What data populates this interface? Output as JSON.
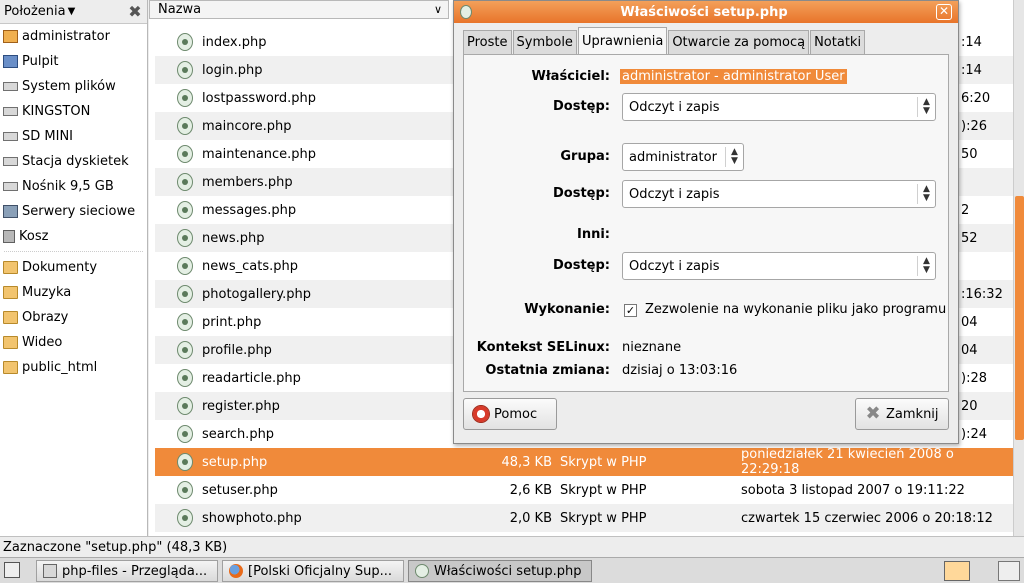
{
  "places": {
    "header_label": "Położenia",
    "items": [
      {
        "label": "administrator",
        "icon": "home-icon"
      },
      {
        "label": "Pulpit",
        "icon": "desktop-icon"
      },
      {
        "label": "System plików",
        "icon": "drive-icon"
      },
      {
        "label": "KINGSTON",
        "icon": "drive-icon"
      },
      {
        "label": "SD MINI",
        "icon": "drive-icon"
      },
      {
        "label": "Stacja dyskietek",
        "icon": "drive-icon"
      },
      {
        "label": "Nośnik 9,5 GB",
        "icon": "drive-icon"
      },
      {
        "label": "Serwery sieciowe",
        "icon": "network-icon"
      },
      {
        "label": "Kosz",
        "icon": "trash-icon"
      }
    ],
    "bookmarks": [
      {
        "label": "Dokumenty",
        "icon": "folder-icon"
      },
      {
        "label": "Muzyka",
        "icon": "folder-icon"
      },
      {
        "label": "Obrazy",
        "icon": "folder-icon"
      },
      {
        "label": "Wideo",
        "icon": "folder-icon"
      },
      {
        "label": "public_html",
        "icon": "folder-icon"
      }
    ]
  },
  "file_list": {
    "column_name": "Nazwa",
    "rows": [
      {
        "name": "index.php",
        "size": "",
        "type": "",
        "date": "",
        "date_part": ":14"
      },
      {
        "name": "login.php",
        "size": "",
        "type": "",
        "date": "",
        "date_part": ":14"
      },
      {
        "name": "lostpassword.php",
        "size": "",
        "type": "",
        "date": "",
        "date_part": "6:20"
      },
      {
        "name": "maincore.php",
        "size": "",
        "type": "",
        "date": "",
        "date_part": "):26"
      },
      {
        "name": "maintenance.php",
        "size": "",
        "type": "",
        "date": "",
        "date_part": "50"
      },
      {
        "name": "members.php",
        "size": "",
        "type": "",
        "date": "",
        "date_part": ""
      },
      {
        "name": "messages.php",
        "size": "",
        "type": "",
        "date": "",
        "date_part": "2"
      },
      {
        "name": "news.php",
        "size": "",
        "type": "",
        "date": "",
        "date_part": "52"
      },
      {
        "name": "news_cats.php",
        "size": "",
        "type": "",
        "date": "",
        "date_part": ""
      },
      {
        "name": "photogallery.php",
        "size": "",
        "type": "",
        "date": "",
        "date_part": ":16:32"
      },
      {
        "name": "print.php",
        "size": "",
        "type": "",
        "date": "",
        "date_part": "04"
      },
      {
        "name": "profile.php",
        "size": "",
        "type": "",
        "date": "",
        "date_part": "04"
      },
      {
        "name": "readarticle.php",
        "size": "",
        "type": "",
        "date": "",
        "date_part": "):28"
      },
      {
        "name": "register.php",
        "size": "",
        "type": "",
        "date": "",
        "date_part": "20"
      },
      {
        "name": "search.php",
        "size": "",
        "type": "",
        "date": "",
        "date_part": "):24"
      },
      {
        "name": "setup.php",
        "size": "48,3 KB",
        "type": "Skrypt w PHP",
        "date": "poniedziałek 21 kwiecień 2008 o 22:29:18",
        "date_part": "",
        "selected": true
      },
      {
        "name": "setuser.php",
        "size": "2,6 KB",
        "type": "Skrypt w PHP",
        "date": "sobota 3 listopad 2007 o 19:11:22",
        "date_part": ""
      },
      {
        "name": "showphoto.php",
        "size": "2,0 KB",
        "type": "Skrypt w PHP",
        "date": "czwartek 15 czerwiec 2006 o 20:18:12",
        "date_part": ""
      }
    ]
  },
  "dialog": {
    "title": "Właściwości setup.php",
    "tabs": [
      "Proste",
      "Symbole",
      "Uprawnienia",
      "Otwarcie za pomocą",
      "Notatki"
    ],
    "active_tab": "Uprawnienia",
    "owner_label": "Właściciel:",
    "owner_value": "administrator - administrator User",
    "owner_access_label": "Dostęp:",
    "owner_access_value": "Odczyt i zapis",
    "group_label": "Grupa:",
    "group_value": "administrator",
    "group_access_label": "Dostęp:",
    "group_access_value": "Odczyt i zapis",
    "others_label": "Inni:",
    "others_access_label": "Dostęp:",
    "others_access_value": "Odczyt i zapis",
    "execute_label": "Wykonanie:",
    "execute_checkbox_label": "Zezwolenie na wykonanie pliku jako programu",
    "execute_checked": true,
    "selinux_label": "Kontekst SELinux:",
    "selinux_value": "nieznane",
    "last_change_label": "Ostatnia zmiana:",
    "last_change_value": "dzisiaj o 13:03:16",
    "help_button": "Pomoc",
    "close_button": "Zamknij"
  },
  "statusbar": {
    "text": "Zaznaczone \"setup.php\" (48,3 KB)"
  },
  "taskbar": {
    "tasks": [
      {
        "label": "php-files - Przegląda...",
        "icon": "file-manager-icon"
      },
      {
        "label": "[Polski Oficjalny Sup...",
        "icon": "firefox-icon"
      },
      {
        "label": "Właściwości setup.php",
        "icon": "properties-icon",
        "active": true
      }
    ]
  },
  "colors": {
    "accent": "#f08a3a",
    "window_bg": "#ededed",
    "panel_bg": "#f7f7f7"
  }
}
